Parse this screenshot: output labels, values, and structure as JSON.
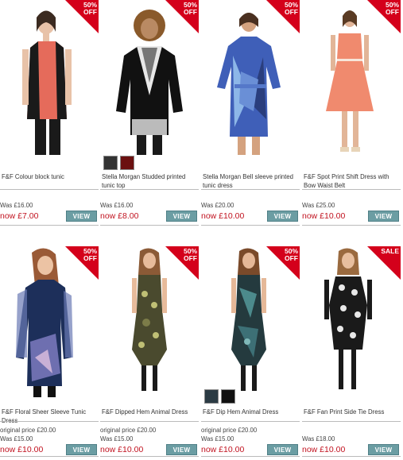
{
  "products_row1": [
    {
      "name": "F&F Colour block tunic",
      "was": "Was £16.00",
      "now": "now £7.00",
      "badge": "50% OFF",
      "view": "VIEW"
    },
    {
      "name": "Stella Morgan Studded printed tunic top",
      "was": "Was £16.00",
      "now": "now £8.00",
      "badge": "50% OFF",
      "view": "VIEW"
    },
    {
      "name": "Stella Morgan Bell sleeve printed tunic dress",
      "was": "Was £20.00",
      "now": "now £10.00",
      "badge": "50% OFF",
      "view": "VIEW"
    },
    {
      "name": "F&F Spot Print Shift Dress with Bow Waist Belt",
      "was": "Was £25.00",
      "now": "now £10.00",
      "badge": "50% OFF",
      "view": "VIEW"
    }
  ],
  "products_row2": [
    {
      "name": "F&F Floral Sheer Sleeve Tunic Dress",
      "orig": "original price £20.00",
      "was": "Was £15.00",
      "now": "now £10.00",
      "badge": "50% OFF",
      "view": "VIEW"
    },
    {
      "name": "F&F Dipped Hem Animal Dress",
      "orig": "original price £20.00",
      "was": "Was £15.00",
      "now": "now £10.00",
      "badge": "50% OFF",
      "view": "VIEW"
    },
    {
      "name": "F&F Dip Hem Animal Dress",
      "orig": "original price £20.00",
      "was": "Was £15.00",
      "now": "now £10.00",
      "badge": "50% OFF",
      "view": "VIEW"
    },
    {
      "name": "F&F Fan Print Side Tie Dress",
      "orig": "",
      "was": "Was £18.00",
      "now": "now £10.00",
      "badge": "SALE",
      "view": "VIEW"
    }
  ],
  "colors": {
    "badge": "#d4001b",
    "price": "#c1121f",
    "button": "#6b9da3"
  }
}
